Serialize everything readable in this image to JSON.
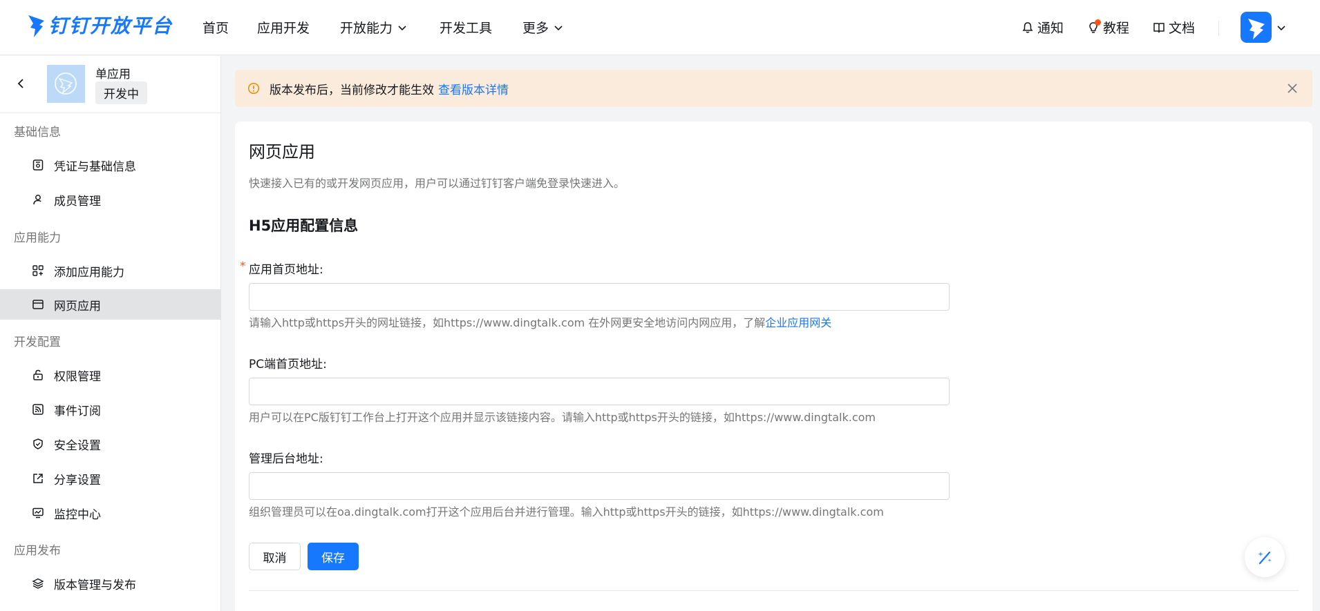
{
  "topnav": {
    "brand": "钉钉开放平台",
    "items": [
      "首页",
      "应用开发",
      "开放能力",
      "开发工具",
      "更多"
    ],
    "right": {
      "notify": "通知",
      "tutorial": "教程",
      "docs": "文档"
    }
  },
  "app": {
    "name": "单应用",
    "status": "开发中"
  },
  "sidebar": {
    "groups": [
      {
        "label": "基础信息",
        "items": [
          "凭证与基础信息",
          "成员管理"
        ]
      },
      {
        "label": "应用能力",
        "items": [
          "添加应用能力",
          "网页应用"
        ]
      },
      {
        "label": "开发配置",
        "items": [
          "权限管理",
          "事件订阅",
          "安全设置",
          "分享设置",
          "监控中心"
        ]
      },
      {
        "label": "应用发布",
        "items": [
          "版本管理与发布"
        ]
      }
    ],
    "active": "网页应用"
  },
  "alert": {
    "text": "版本发布后，当前修改才能生效",
    "link": "查看版本详情"
  },
  "page": {
    "title": "网页应用",
    "desc": "快速接入已有的或开发网页应用，用户可以通过钉钉客户端免登录快速进入。",
    "section": "H5应用配置信息"
  },
  "fields": {
    "home": {
      "label": "应用首页地址:",
      "required": "*",
      "value": "",
      "help": "请输入http或https开头的网址链接，如https://www.dingtalk.com 在外网更安全地访问内网应用，了解",
      "help_link": "企业应用网关"
    },
    "pc": {
      "label": "PC端首页地址:",
      "value": "",
      "help": "用户可以在PC版钉钉工作台上打开这个应用并显示该链接内容。请输入http或https开头的链接，如https://www.dingtalk.com"
    },
    "admin": {
      "label": "管理后台地址:",
      "value": "",
      "help": "组织管理员可以在oa.dingtalk.com打开这个应用后台并进行管理。输入http或https开头的链接，如https://www.dingtalk.com"
    }
  },
  "buttons": {
    "cancel": "取消",
    "save": "保存"
  },
  "colors": {
    "accent": "#1677ff",
    "alert_bg": "#fbebdc",
    "required": "#ff5219"
  }
}
